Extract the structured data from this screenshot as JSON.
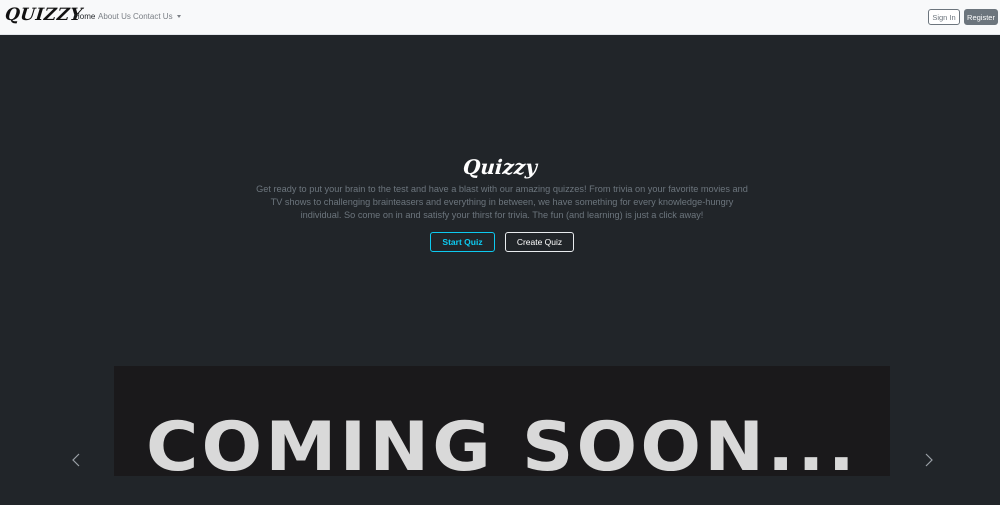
{
  "navbar": {
    "brand": "QUIZZY",
    "links": [
      {
        "label": "Home"
      },
      {
        "label": "About Us"
      },
      {
        "label": "Contact Us"
      }
    ],
    "signin_label": "Sign In",
    "register_label": "Register"
  },
  "hero": {
    "title": "Quizzy",
    "description": "Get ready to put your brain to the test and have a blast with our amazing quizzes! From trivia on your favorite movies and TV shows to challenging brainteasers and everything in between, we have something for every knowledge-hungry individual. So come on in and satisfy your thirst for trivia. The fun (and learning) is just a click away!",
    "start_label": "Start Quiz",
    "create_label": "Create Quiz"
  },
  "carousel": {
    "slide_text": "COMING SOON...",
    "prev_icon": "chevron-left-icon",
    "next_icon": "chevron-right-icon"
  },
  "colors": {
    "navbar_bg": "#f8f9fa",
    "hero_bg": "#212529",
    "accent_info": "#0dcaf0",
    "secondary": "#6c757d"
  }
}
